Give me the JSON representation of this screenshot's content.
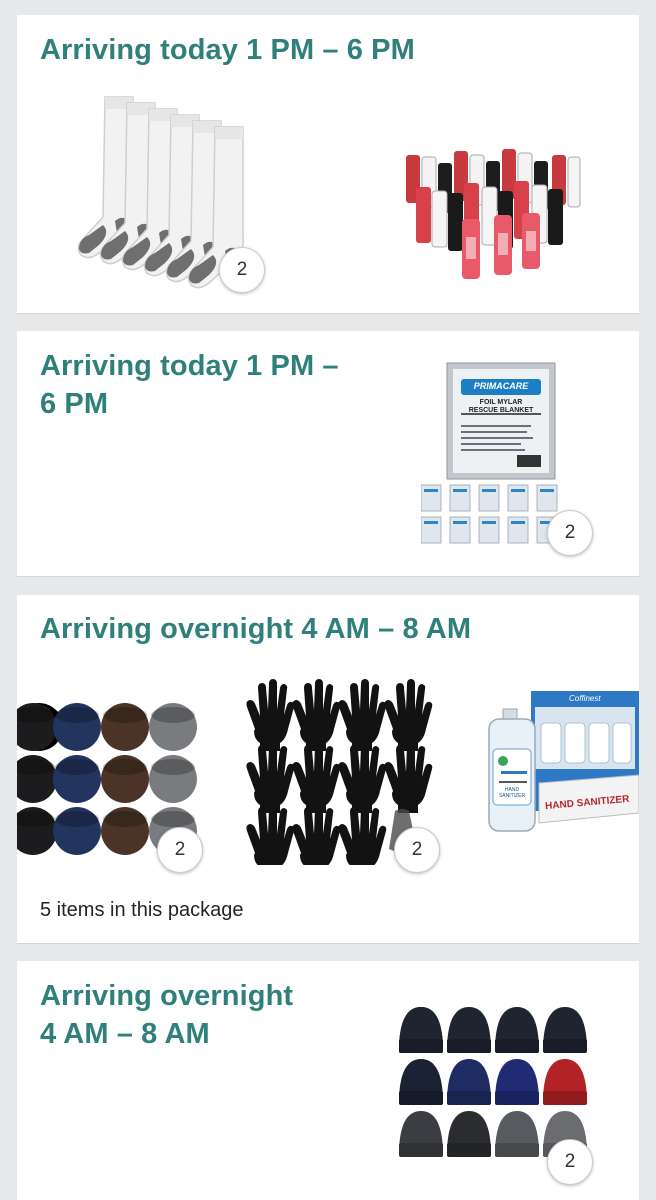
{
  "shipments": [
    {
      "title": "Arriving today 1 PM – 6 PM",
      "items": [
        {
          "product": "white crew socks 6-pack",
          "quantity": "2"
        },
        {
          "product": "lip balm assortment",
          "quantity": ""
        }
      ]
    },
    {
      "title_lines": [
        "Arriving today 1 PM –",
        "6 PM"
      ],
      "items": [
        {
          "product": "foil mylar rescue blanket pack",
          "quantity": "2",
          "package_text": {
            "brand": "PRIMACARE",
            "line1": "FOIL MYLAR",
            "line2": "RESCUE BLANKET"
          }
        }
      ]
    },
    {
      "title": "Arriving overnight 4 AM – 8 AM",
      "items": [
        {
          "product": "fleece neck warmers 12-pack",
          "quantity": "2"
        },
        {
          "product": "black knit gloves 12-pack",
          "quantity": "2"
        },
        {
          "product": "hand sanitizer bottles",
          "quantity": "",
          "package_text": {
            "brand": "Coffinest",
            "line1": "HAND SANITIZER",
            "bottle": "HAND SANITIZER"
          }
        }
      ],
      "items_count": "5 items in this package"
    },
    {
      "title_lines": [
        "Arriving overnight",
        "4 AM – 8 AM"
      ],
      "items": [
        {
          "product": "knit beanies 12-pack",
          "quantity": "2"
        }
      ]
    }
  ],
  "colors": {
    "title": "#2f7f7b",
    "background": "#e7e8ea",
    "card": "#ffffff"
  }
}
